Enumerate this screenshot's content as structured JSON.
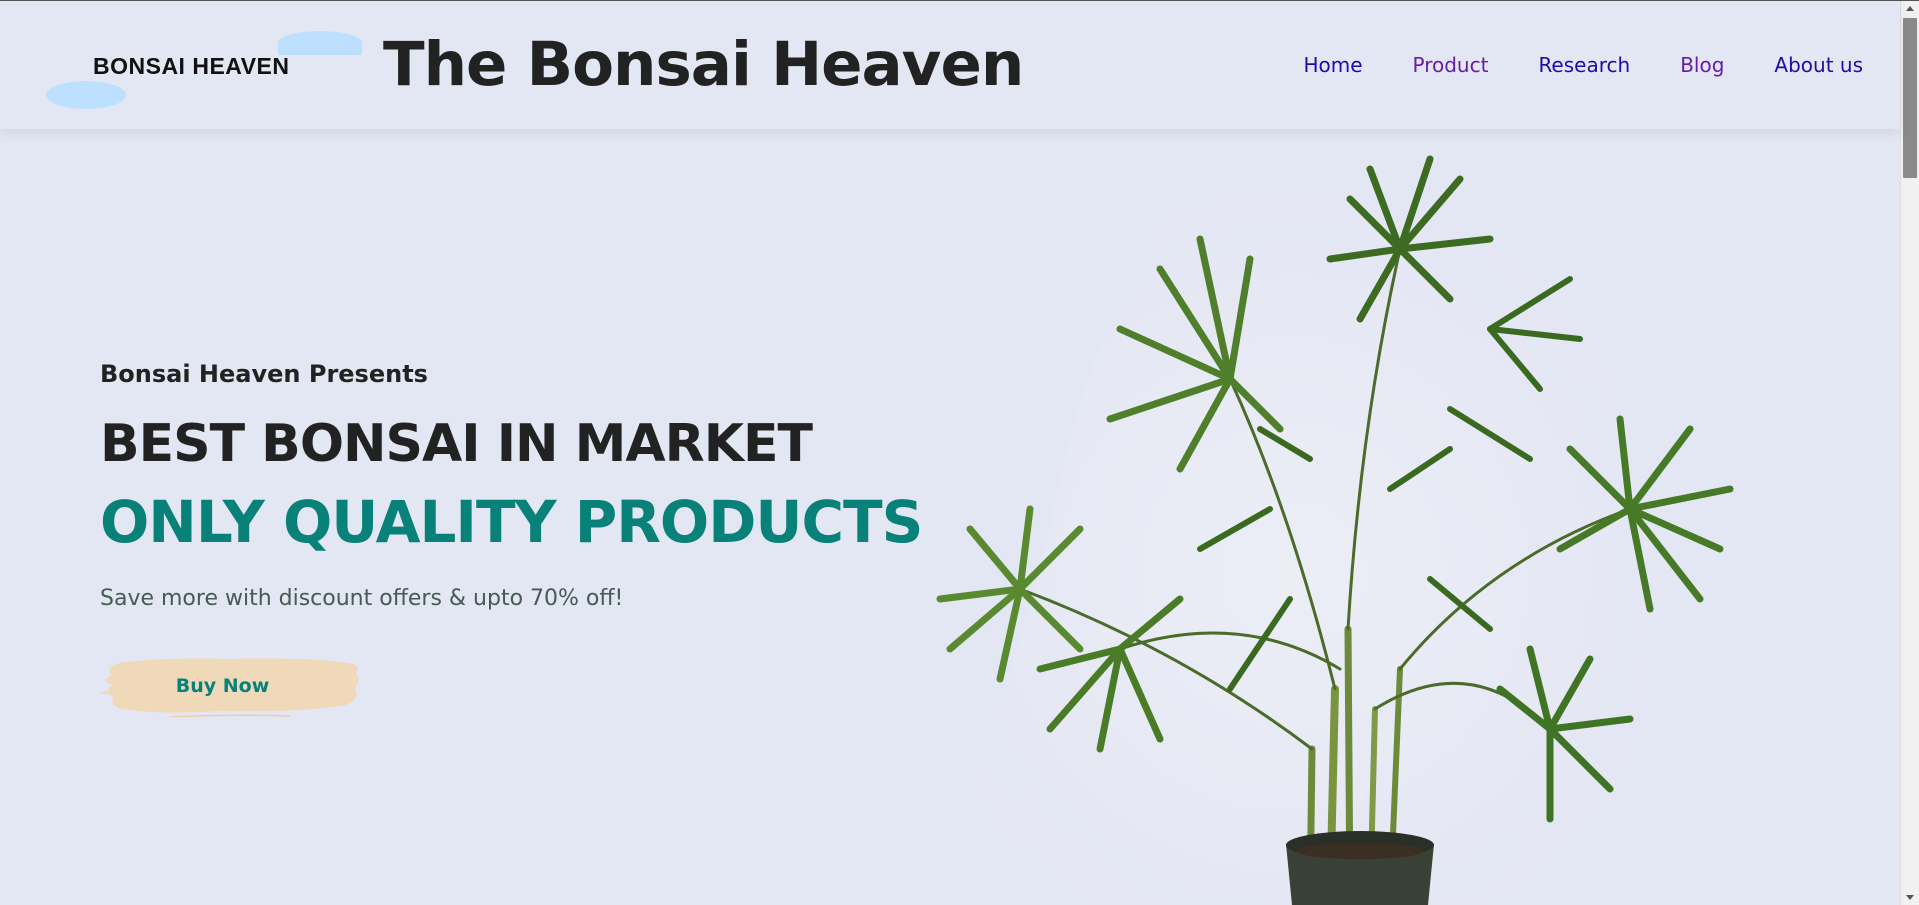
{
  "header": {
    "logo_text": "BONSAI HEAVEN",
    "site_title": "The Bonsai Heaven",
    "nav": [
      {
        "label": "Home",
        "visited": false
      },
      {
        "label": "Product",
        "visited": true
      },
      {
        "label": "Research",
        "visited": false
      },
      {
        "label": "Blog",
        "visited": true
      },
      {
        "label": "About us",
        "visited": false
      }
    ]
  },
  "hero": {
    "presents": "Bonsai Heaven Presents",
    "headline1": "BEST BONSAI IN MARKET",
    "headline2": "ONLY QUALITY PRODUCTS",
    "subtext": "Save more with discount offers & upto 70% off!",
    "cta_label": "Buy Now",
    "image": "potted-palm-plant"
  },
  "colors": {
    "background": "#e3e6f3",
    "accent": "#088178",
    "logo_blob": "#bde0fe",
    "button_brush": "#f0d9b9",
    "nav_link": "#1a0dab",
    "nav_visited": "#681da8"
  }
}
